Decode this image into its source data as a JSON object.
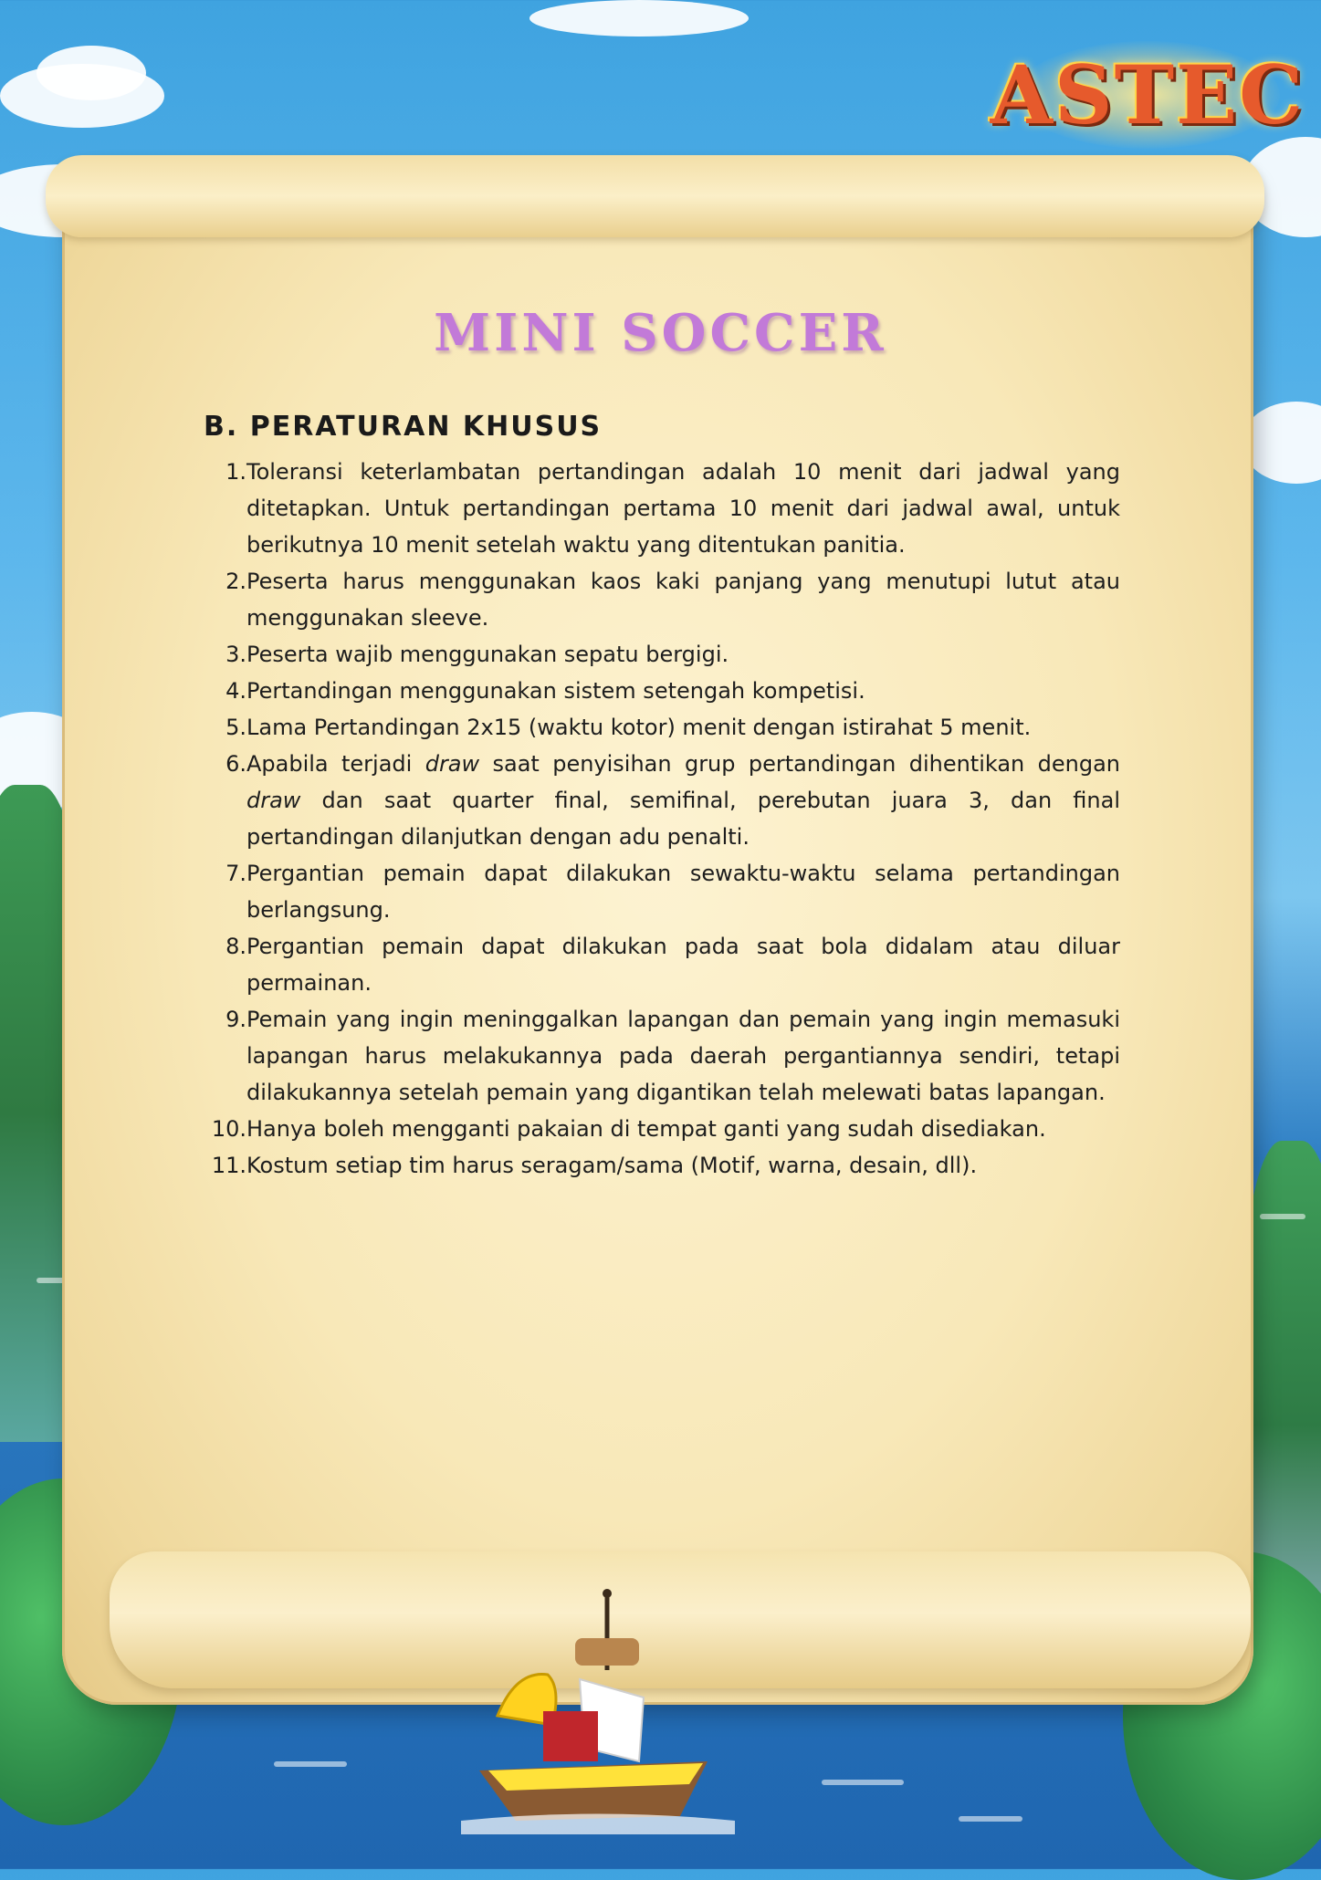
{
  "logo": {
    "text": "ASTEC"
  },
  "title": "MINI SOCCER",
  "section_heading": "B. PERATURAN KHUSUS",
  "rules": [
    {
      "num": "1.",
      "text": "Toleransi keterlambatan pertandingan adalah 10 menit dari jadwal yang ditetapkan. Untuk pertandingan pertama 10 menit dari jadwal awal, untuk berikutnya 10 menit setelah waktu yang ditentukan panitia."
    },
    {
      "num": "2.",
      "text": "Peserta harus menggunakan kaos kaki panjang yang menutupi lutut atau menggunakan sleeve."
    },
    {
      "num": "3.",
      "text": "Peserta wajib menggunakan sepatu bergigi."
    },
    {
      "num": "4.",
      "text": "Pertandingan menggunakan sistem setengah kompetisi."
    },
    {
      "num": "5.",
      "text": "Lama Pertandingan 2x15 (waktu kotor) menit dengan istirahat 5 menit."
    },
    {
      "num": "6.",
      "text_parts": [
        "Apabila terjadi ",
        "draw",
        " saat penyisihan grup pertandingan dihentikan dengan ",
        "draw",
        " dan saat quarter final, semifinal, perebutan juara 3, dan final pertandingan dilanjutkan dengan adu penalti."
      ]
    },
    {
      "num": "7.",
      "text": "Pergantian pemain dapat dilakukan sewaktu-waktu selama pertandingan berlangsung."
    },
    {
      "num": "8.",
      "text": "Pergantian pemain dapat dilakukan pada saat bola didalam atau diluar permainan."
    },
    {
      "num": "9.",
      "text": "Pemain yang ingin meninggalkan lapangan dan pemain yang ingin memasuki lapangan harus melakukannya pada daerah pergantiannya sendiri, tetapi dilakukannya setelah pemain yang digantikan telah melewati batas lapangan."
    },
    {
      "num": "10.",
      "text": "Hanya boleh mengganti pakaian di tempat ganti yang sudah disediakan."
    },
    {
      "num": "11.",
      "text": "Kostum setiap tim harus seragam/sama (Motif, warna, desain, dll)."
    }
  ],
  "colors": {
    "title": "#c27ad8",
    "parchment": "#f8e8b8",
    "sky": "#5db7ec",
    "sea": "#1f66b0"
  }
}
